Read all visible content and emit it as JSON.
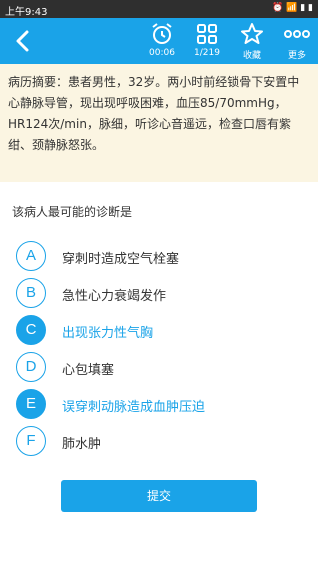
{
  "status_bar": {
    "time": "上午9:43",
    "indicators": "⏰ 📶 ▮ ▮"
  },
  "toolbar": {
    "timer": "00:06",
    "progress": "1/219",
    "favorite_label": "收藏",
    "more_label": "更多",
    "icons": [
      "back-arrow-icon",
      "alarm-clock-icon",
      "grid-icon",
      "star-icon",
      "more-dots-icon"
    ]
  },
  "case_summary": "病历摘要：患者男性，32岁。两小时前经锁骨下安置中心静脉导管，现出现呼吸困难，血压85/70mmHg，HR124次/min，脉细，听诊心音遥远，检查口唇有紫绀、颈静脉怒张。",
  "question": "该病人最可能的诊断是",
  "options": [
    {
      "letter": "A",
      "text": "穿刺时造成空气栓塞",
      "selected": false
    },
    {
      "letter": "B",
      "text": "急性心力衰竭发作",
      "selected": false
    },
    {
      "letter": "C",
      "text": "出现张力性气胸",
      "selected": true
    },
    {
      "letter": "D",
      "text": "心包填塞",
      "selected": false
    },
    {
      "letter": "E",
      "text": "误穿刺动脉造成血肿压迫",
      "selected": true
    },
    {
      "letter": "F",
      "text": "肺水肿",
      "selected": false
    }
  ],
  "submit_label": "提交",
  "colors": {
    "accent": "#1aa3e8",
    "case_bg": "#fbf5e2",
    "status_bar": "#2f2f2f"
  }
}
